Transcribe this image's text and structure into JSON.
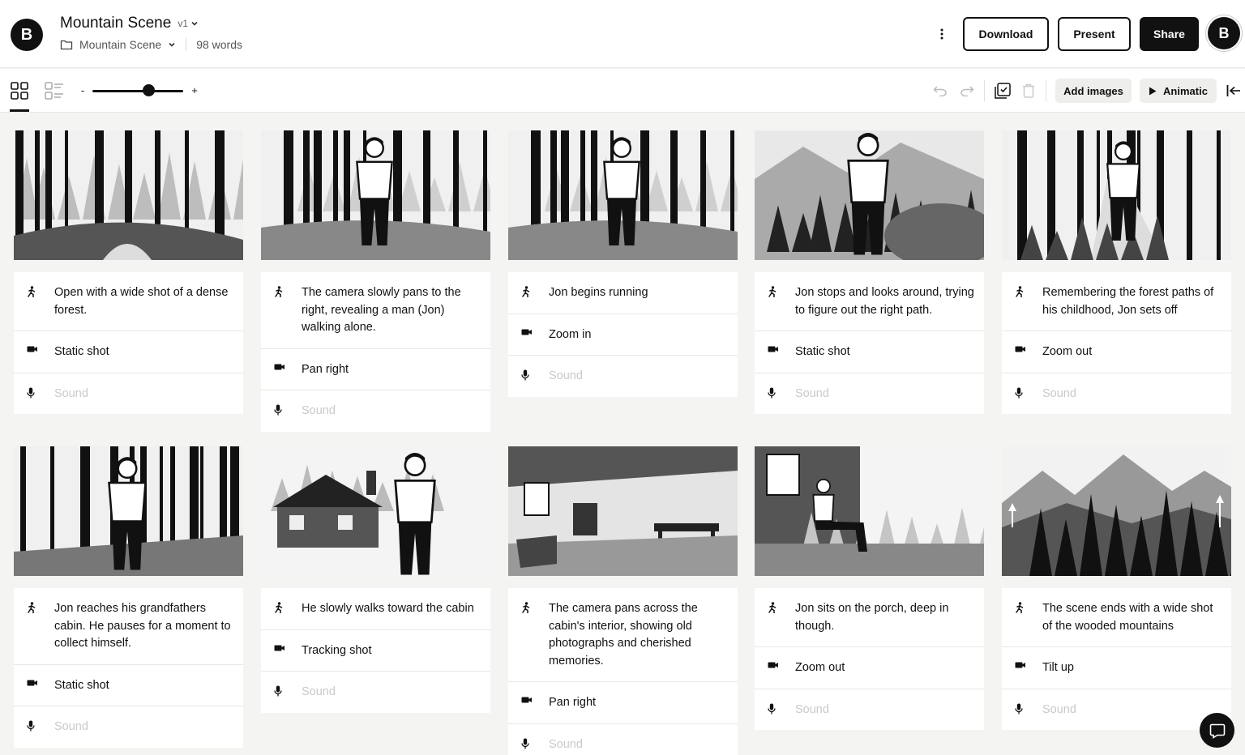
{
  "app": {
    "logo_letter": "B",
    "title": "Mountain Scene",
    "version": "v1",
    "folder": "Mountain Scene",
    "word_count": "98 words"
  },
  "header_actions": {
    "download": "Download",
    "present": "Present",
    "share": "Share",
    "avatar_letter": "B"
  },
  "toolbar": {
    "zoom_minus": "-",
    "zoom_plus": "+",
    "zoom_level": 0.62,
    "add_images": "Add images",
    "animatic": "Animatic"
  },
  "frames": [
    {
      "description": "Open with a wide shot of a dense forest.",
      "camera": "Static shot",
      "sound_placeholder": "Sound",
      "image": "forest-wide"
    },
    {
      "description": "The camera slowly pans to the right, revealing a man (Jon) walking alone.",
      "camera": "Pan right",
      "sound_placeholder": "Sound",
      "image": "man-walking-forest"
    },
    {
      "description": "Jon begins running",
      "camera": "Zoom in",
      "sound_placeholder": "Sound",
      "image": "man-running-forest"
    },
    {
      "description": "Jon stops and looks around, trying to figure out the right path.",
      "camera": "Static shot",
      "sound_placeholder": "Sound",
      "image": "man-in-valley"
    },
    {
      "description": "Remembering the forest paths of his childhood, Jon sets off",
      "camera": "Zoom out",
      "sound_placeholder": "Sound",
      "image": "man-on-path"
    },
    {
      "description": "Jon reaches his grandfathers cabin. He pauses for a moment to collect himself.",
      "camera": "Static shot",
      "sound_placeholder": "Sound",
      "image": "man-from-behind-forest"
    },
    {
      "description": "He slowly walks toward the cabin",
      "camera": "Tracking shot",
      "sound_placeholder": "Sound",
      "image": "man-approaching-cabin"
    },
    {
      "description": "The camera pans across the cabin's interior, showing old photographs and cherished memories.",
      "camera": "Pan right",
      "sound_placeholder": "Sound",
      "image": "cabin-interior"
    },
    {
      "description": "Jon sits on the porch, deep in though.",
      "camera": "Zoom out",
      "sound_placeholder": "Sound",
      "image": "man-on-porch"
    },
    {
      "description": "The scene ends with a wide shot of the wooded mountains",
      "camera": "Tilt up",
      "sound_placeholder": "Sound",
      "image": "mountains-wide"
    }
  ],
  "colors": {
    "accent": "#111111",
    "background": "#f4f4f2",
    "placeholder": "#c9c9c7"
  }
}
